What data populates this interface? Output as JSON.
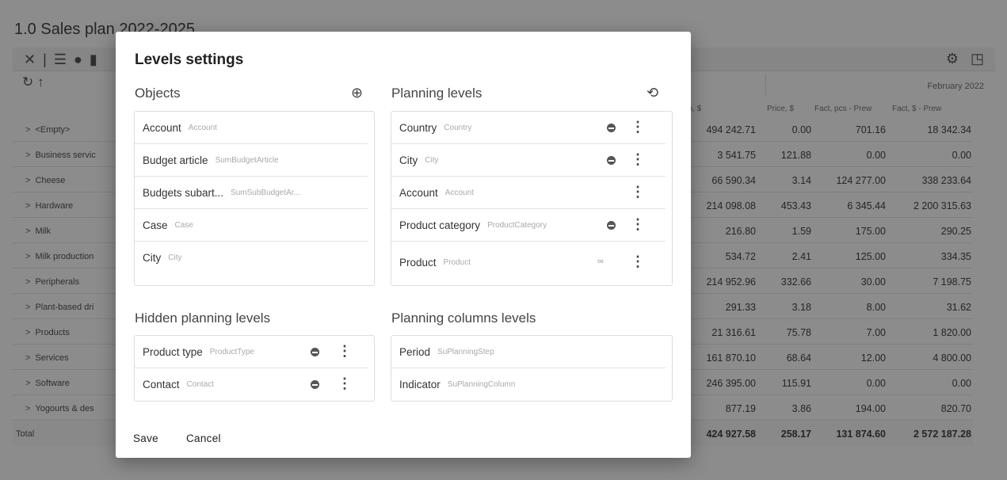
{
  "page": {
    "title": "1.0 Sales plan 2022-2025",
    "month": "February 2022",
    "columns": [
      "Plan, $",
      "Price, $",
      "Fact, pcs - Prew",
      "Fact, $ - Prew"
    ],
    "rows": [
      {
        "label": "<Empty>",
        "plan": "494 242.71",
        "price": "0.00",
        "fact_pcs": "701.16",
        "fact_usd": "18 342.34"
      },
      {
        "label": "Business servic",
        "plan": "3 541.75",
        "price": "121.88",
        "fact_pcs": "0.00",
        "fact_usd": "0.00"
      },
      {
        "label": "Cheese",
        "plan": "66 590.34",
        "price": "3.14",
        "fact_pcs": "124 277.00",
        "fact_usd": "338 233.64"
      },
      {
        "label": "Hardware",
        "plan": "214 098.08",
        "price": "453.43",
        "fact_pcs": "6 345.44",
        "fact_usd": "2 200 315.63"
      },
      {
        "label": "Milk",
        "plan": "216.80",
        "price": "1.59",
        "fact_pcs": "175.00",
        "fact_usd": "290.25"
      },
      {
        "label": "Milk production",
        "plan": "534.72",
        "price": "2.41",
        "fact_pcs": "125.00",
        "fact_usd": "334.35"
      },
      {
        "label": "Peripherals",
        "plan": "214 952.96",
        "price": "332.66",
        "fact_pcs": "30.00",
        "fact_usd": "7 198.75"
      },
      {
        "label": "Plant-based dri",
        "plan": "291.33",
        "price": "3.18",
        "fact_pcs": "8.00",
        "fact_usd": "31.62"
      },
      {
        "label": "Products",
        "plan": "21 316.61",
        "price": "75.78",
        "fact_pcs": "7.00",
        "fact_usd": "1 820.00"
      },
      {
        "label": "Services",
        "plan": "161 870.10",
        "price": "68.64",
        "fact_pcs": "12.00",
        "fact_usd": "4 800.00"
      },
      {
        "label": "Software",
        "plan": "246 395.00",
        "price": "115.91",
        "fact_pcs": "0.00",
        "fact_usd": "0.00"
      },
      {
        "label": "Yogourts & des",
        "plan": "877.19",
        "price": "3.86",
        "fact_pcs": "194.00",
        "fact_usd": "820.70"
      }
    ],
    "total": {
      "label": "Total",
      "plan": "424 927.58",
      "price": "258.17",
      "fact_pcs": "131 874.60",
      "fact_usd": "2 572 187.28"
    }
  },
  "modal": {
    "title": "Levels settings",
    "objects": {
      "title": "Objects",
      "items": [
        {
          "name": "Account",
          "code": "Account"
        },
        {
          "name": "Budget article",
          "code": "SumBudgetArticle"
        },
        {
          "name": "Budgets subart...",
          "code": "SumSubBudgetAr..."
        },
        {
          "name": "Case",
          "code": "Case"
        },
        {
          "name": "City",
          "code": "City"
        }
      ]
    },
    "planning_levels": {
      "title": "Planning levels",
      "items": [
        {
          "name": "Country",
          "code": "Country"
        },
        {
          "name": "City",
          "code": "City"
        },
        {
          "name": "Account",
          "code": "Account"
        },
        {
          "name": "Product category",
          "code": "ProductCategory"
        },
        {
          "name": "Product",
          "code": "Product"
        }
      ]
    },
    "hidden_levels": {
      "title": "Hidden planning levels",
      "items": [
        {
          "name": "Product type",
          "code": "ProductType"
        },
        {
          "name": "Contact",
          "code": "Contact"
        }
      ]
    },
    "column_levels": {
      "title": "Planning columns levels",
      "items": [
        {
          "name": "Period",
          "code": "SuPlanningStep"
        },
        {
          "name": "Indicator",
          "code": "SuPlanningColumn"
        }
      ]
    },
    "save_label": "Save",
    "cancel_label": "Cancel"
  },
  "icons": {
    "add": "plus-circle-icon",
    "refresh": "sync-icon",
    "remove": "minus-circle-icon",
    "more": "more-vertical-icon",
    "link": "link-icon"
  }
}
